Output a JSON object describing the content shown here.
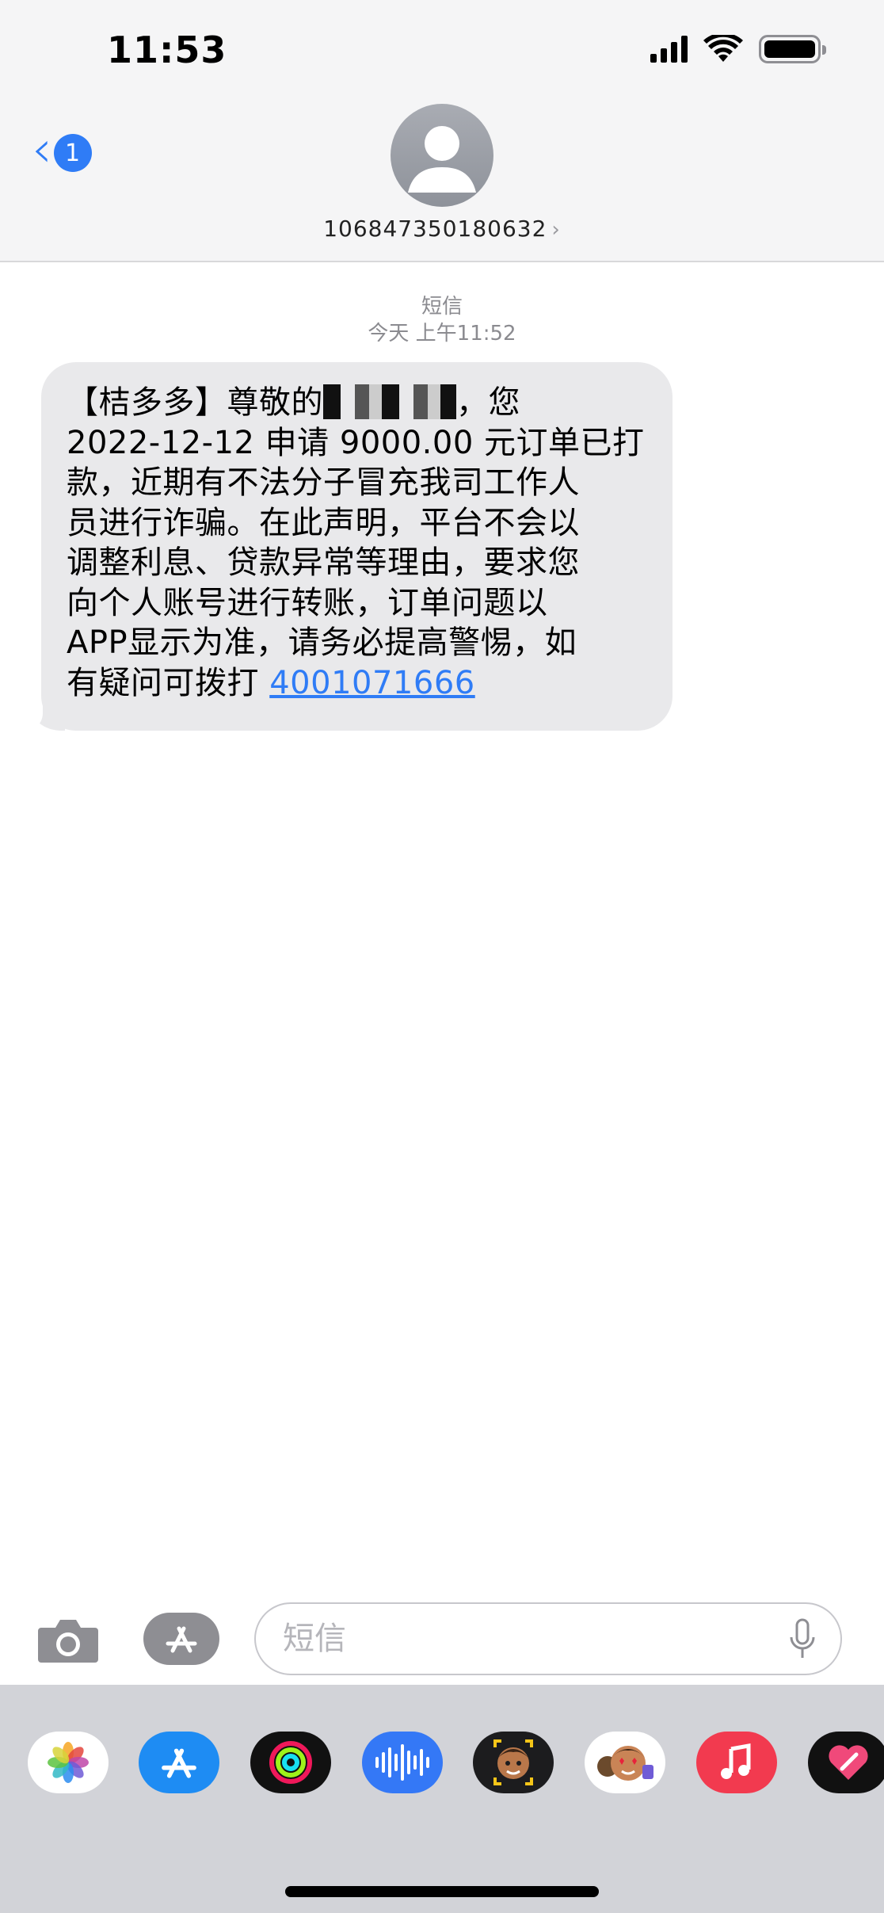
{
  "status_bar": {
    "time": "11:53"
  },
  "nav": {
    "back_badge_count": "1",
    "back_icon": "chevron-left-icon"
  },
  "contact": {
    "number": "106847350180632",
    "avatar_icon": "person-placeholder-icon"
  },
  "thread": {
    "service_label": "短信",
    "timestamp": "今天 上午11:52"
  },
  "message": {
    "line1_prefix": "【桔多多】尊敬的",
    "line1_suffix": "，您",
    "line2": "2022-12-12 申请 9000.00 元订单已打",
    "line3": "款，近期有不法分子冒充我司工作人",
    "line4": "员进行诈骗。在此声明，平台不会以",
    "line5": "调整利息、贷款异常等理由，要求您",
    "line6": "向个人账号进行转账，订单问题以",
    "line7": "APP显示为准，请务必提高警惕，如",
    "line8_prefix": "有疑问可拨打 ",
    "phone_link": "4001071666"
  },
  "compose": {
    "placeholder": "短信",
    "value": ""
  },
  "app_drawer": {
    "apps": [
      {
        "name": "photos-app-icon",
        "bg": "#ffffff"
      },
      {
        "name": "app-store-app-icon",
        "bg": "#1e8cf3"
      },
      {
        "name": "fitness-app-icon",
        "bg": "#111111"
      },
      {
        "name": "audio-message-app-icon",
        "bg": "#3478f6"
      },
      {
        "name": "memoji-app-icon",
        "bg": "#1c1c1e"
      },
      {
        "name": "memoji-stickers-app-icon",
        "bg": "#ffffff"
      },
      {
        "name": "music-app-icon",
        "bg": "#f23a4f"
      },
      {
        "name": "digital-touch-app-icon",
        "bg": "#111111"
      }
    ]
  },
  "colors": {
    "accent": "#2f7cf6",
    "bubble": "#e9e9eb",
    "header_bg": "#f5f5f6",
    "drawer_bg": "#d2d3d8"
  }
}
